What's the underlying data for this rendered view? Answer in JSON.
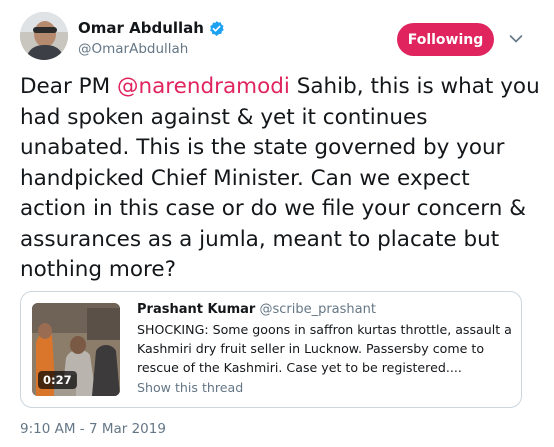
{
  "author": {
    "display_name": "Omar Abdullah",
    "handle": "@OmarAbdullah",
    "verified": true
  },
  "follow_button": {
    "label": "Following",
    "color": "#e0245e"
  },
  "tweet": {
    "text_before_mention": "Dear PM ",
    "mention": "@narendramodi",
    "text_after_mention": " Sahib, this is what you had spoken against & yet it continues unabated. This is the state governed by your handpicked Chief Minister. Can we expect action in this case or do we file your concern & assurances as a jumla, meant to placate but nothing more?",
    "timestamp": "9:10 AM - 7 Mar 2019"
  },
  "quoted_tweet": {
    "display_name": "Prashant Kumar",
    "handle": "@scribe_prashant",
    "text": "SHOCKING: Some goons in saffron kurtas throttle, assault a Kashmiri dry fruit seller in Lucknow. Passersby come to rescue of the Kashmiri. Case yet to be registered....",
    "show_thread": "Show this thread",
    "media_duration": "0:27"
  },
  "colors": {
    "accent": "#e0245e",
    "verified": "#1da1f2",
    "secondary_text": "#657786",
    "border": "#ccd6dd"
  }
}
